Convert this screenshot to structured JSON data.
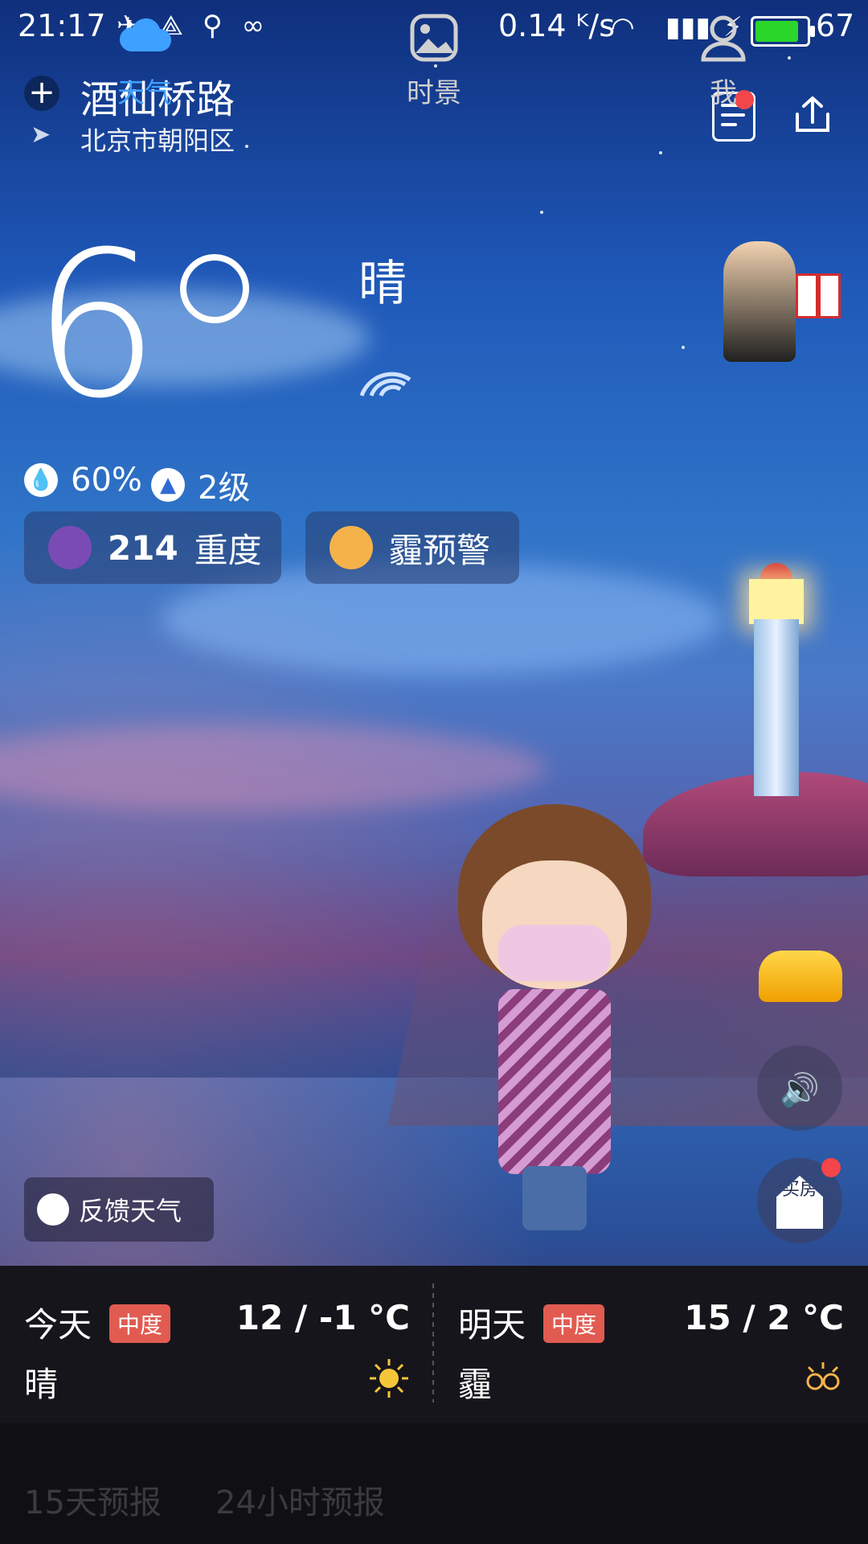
{
  "status_bar": {
    "time": "21:17",
    "network_speed": "0.14 ᴷ/s",
    "battery_percent": "67",
    "battery_level": 0.85,
    "icons": [
      "qq-icon",
      "usb-share-icon",
      "usb-icon",
      "infinity-icon",
      "wifi-icon",
      "signal-3g-icon",
      "charging-bolt-icon",
      "battery-icon"
    ]
  },
  "location": {
    "city": "酒仙桥路",
    "district": "北京市朝阳区"
  },
  "current": {
    "temperature": "6",
    "condition": "晴",
    "humidity": "60%",
    "wind": "2级",
    "aqi_value": "214",
    "aqi_level": "重度",
    "warning": "霾预警"
  },
  "feedback": {
    "label": "反馈天气"
  },
  "forecast": {
    "today": {
      "day": "今天",
      "aqi_badge": "中度",
      "range": "12 / -1 °C",
      "condition": "晴"
    },
    "tomorrow": {
      "day": "明天",
      "aqi_badge": "中度",
      "range": "15 / 2 °C",
      "condition": "霾"
    }
  },
  "tabs": {
    "weather": "天气",
    "scene": "时景",
    "me": "我"
  },
  "ghost_tabs": {
    "left": "15天预报",
    "right": "24小时预报"
  },
  "house_button_label": "买房",
  "colors": {
    "accent_blue": "#3ea0ff",
    "aqi_badge_red": "#e15b51",
    "notification_red": "#f2464a",
    "battery_green": "#2bd62b"
  }
}
